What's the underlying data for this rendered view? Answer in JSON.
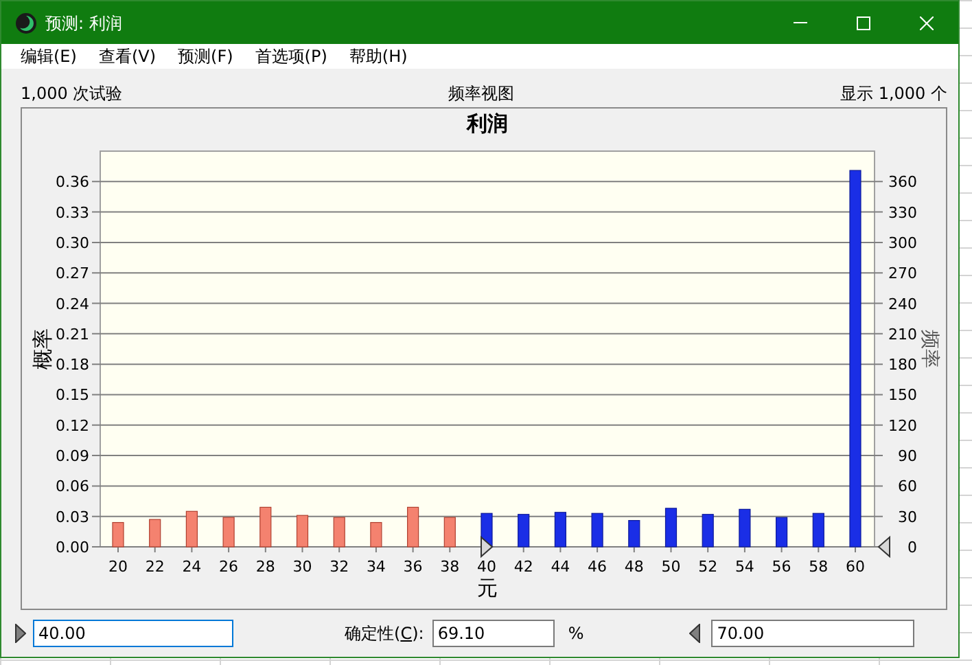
{
  "window": {
    "title": "预测: 利润"
  },
  "menu": [
    "编辑(E)",
    "查看(V)",
    "预测(F)",
    "首选项(P)",
    "帮助(H)"
  ],
  "header": {
    "trials": "1,000 次试验",
    "view": "频率视图",
    "shown": "显示 1,000 个"
  },
  "chart": {
    "chart_data": {
      "type": "bar",
      "title": "利润",
      "xlabel": "元",
      "ylabel": "概率",
      "y2label": "频率",
      "categories": [
        "20",
        "22",
        "24",
        "26",
        "28",
        "30",
        "32",
        "34",
        "36",
        "38",
        "40",
        "42",
        "44",
        "46",
        "48",
        "50",
        "52",
        "54",
        "56",
        "58",
        "60"
      ],
      "series": [
        {
          "color": "#f4826f",
          "values": [
            0.024,
            0.027,
            0.035,
            0.029,
            0.039,
            0.031,
            0.029,
            0.024,
            0.039,
            0.029,
            null,
            null,
            null,
            null,
            null,
            null,
            null,
            null,
            null,
            null,
            null
          ]
        },
        {
          "color": "#1a2ee6",
          "values": [
            null,
            null,
            null,
            null,
            null,
            null,
            null,
            null,
            null,
            null,
            0.033,
            0.032,
            0.034,
            0.033,
            0.026,
            0.038,
            0.032,
            0.037,
            0.029,
            0.033,
            0.371
          ]
        }
      ],
      "ylim": [
        0,
        0.39
      ],
      "grid": true,
      "yticks": [
        {
          "value": 0,
          "label": "0.00"
        },
        {
          "value": 0.03,
          "label": "0.03"
        },
        {
          "value": 0.06,
          "label": "0.06"
        },
        {
          "value": 0.09,
          "label": "0.09"
        },
        {
          "value": 0.12,
          "label": "0.12"
        },
        {
          "value": 0.15,
          "label": "0.15"
        },
        {
          "value": 0.18,
          "label": "0.18"
        },
        {
          "value": 0.21,
          "label": "0.21"
        },
        {
          "value": 0.24,
          "label": "0.24"
        },
        {
          "value": 0.27,
          "label": "0.27"
        },
        {
          "value": 0.3,
          "label": "0.30"
        },
        {
          "value": 0.33,
          "label": "0.33"
        },
        {
          "value": 0.36,
          "label": "0.36"
        }
      ],
      "y2ticks": [
        "0",
        "30",
        "60",
        "90",
        "120",
        "150",
        "180",
        "210",
        "240",
        "270",
        "300",
        "330",
        "360"
      ]
    }
  },
  "certainty": {
    "lower": "40.00",
    "lower_focused": true,
    "label": "确定性(**C**):",
    "value": "69.10",
    "unit": "%",
    "upper": "70.00"
  }
}
